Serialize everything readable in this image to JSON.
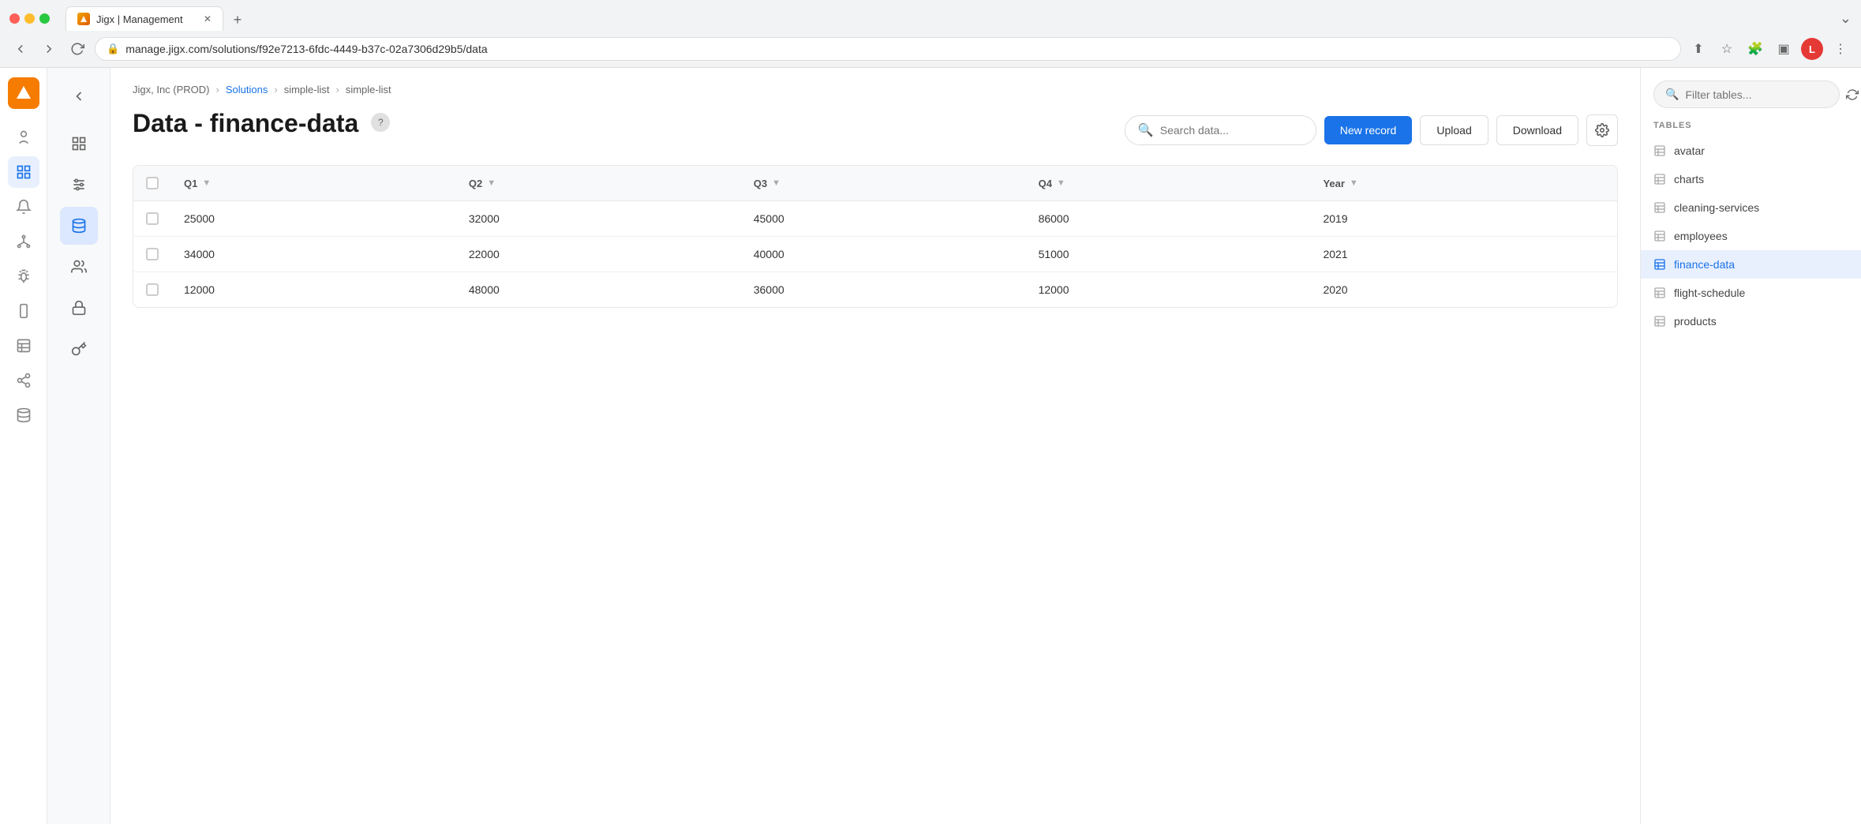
{
  "browser": {
    "tab_title": "Jigx | Management",
    "url_display": "manage.jigx.com/solutions/f92e7213-6fdc-4449-b37c-02a7306d29b5/data",
    "url_bold": "manage.jigx.com",
    "url_rest": "/solutions/f92e7213-6fdc-4449-b37c-02a7306d29b5/data"
  },
  "breadcrumb": {
    "org": "Jigx, Inc (PROD)",
    "solutions": "Solutions",
    "solution": "simple-list",
    "table": "simple-list"
  },
  "page": {
    "title": "Data - finance-data",
    "help_label": "?",
    "search_placeholder": "Search data...",
    "new_record_label": "New record",
    "upload_label": "Upload",
    "download_label": "Download"
  },
  "table": {
    "columns": [
      {
        "key": "q1",
        "label": "Q1"
      },
      {
        "key": "q2",
        "label": "Q2"
      },
      {
        "key": "q3",
        "label": "Q3"
      },
      {
        "key": "q4",
        "label": "Q4"
      },
      {
        "key": "year",
        "label": "Year"
      }
    ],
    "rows": [
      {
        "q1": "25000",
        "q2": "32000",
        "q3": "45000",
        "q4": "86000",
        "year": "2019"
      },
      {
        "q1": "34000",
        "q2": "22000",
        "q3": "40000",
        "q4": "51000",
        "year": "2021"
      },
      {
        "q1": "12000",
        "q2": "48000",
        "q3": "36000",
        "q4": "12000",
        "year": "2020"
      }
    ]
  },
  "tables_sidebar": {
    "filter_placeholder": "Filter tables...",
    "tables_label": "TABLES",
    "items": [
      {
        "name": "avatar"
      },
      {
        "name": "charts"
      },
      {
        "name": "cleaning-services"
      },
      {
        "name": "employees"
      },
      {
        "name": "finance-data",
        "active": true
      },
      {
        "name": "flight-schedule"
      },
      {
        "name": "products"
      }
    ]
  },
  "left_sidebar": {
    "icons": [
      "brand",
      "users",
      "data",
      "bell",
      "tree",
      "bug",
      "phone",
      "table",
      "share",
      "database"
    ]
  },
  "secondary_sidebar": {
    "icons": [
      "back",
      "grid",
      "controls",
      "users",
      "lock",
      "key"
    ]
  }
}
